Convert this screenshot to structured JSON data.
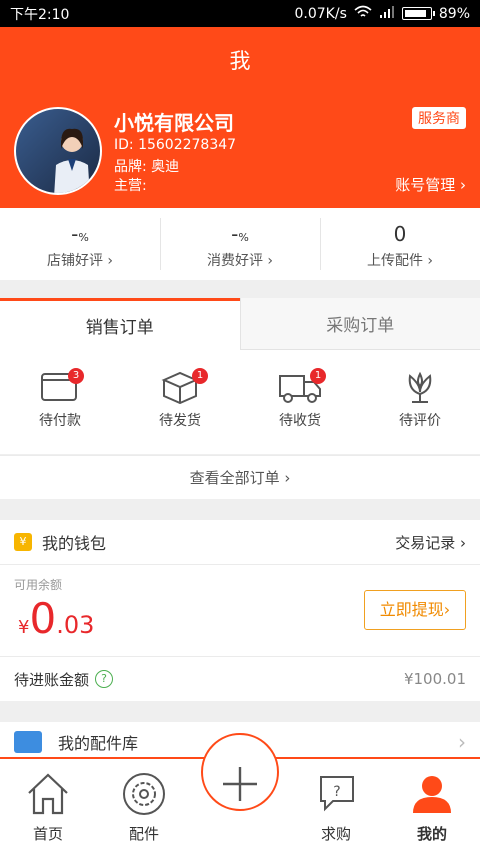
{
  "status_bar": {
    "time": "下午2:10",
    "speed": "0.07K/s",
    "battery": "89%",
    "battery_level": 0.89
  },
  "header": {
    "title": "我",
    "company": "小悦有限公司",
    "id_line": "ID: 15602278347",
    "brand_line": "品牌: 奥迪",
    "main_line": "主营:",
    "service_badge": "服务商",
    "account_mgmt": "账号管理 ›"
  },
  "stats": [
    {
      "value": "-",
      "unit": "%",
      "label": "店铺好评 ›"
    },
    {
      "value": "-",
      "unit": "%",
      "label": "消费好评 ›"
    },
    {
      "value": "0",
      "unit": "",
      "label": "上传配件 ›"
    }
  ],
  "order_tabs": {
    "sales": "销售订单",
    "purchase": "采购订单"
  },
  "order_status": [
    {
      "label": "待付款",
      "icon": "wallet-icon",
      "badge": "3"
    },
    {
      "label": "待发货",
      "icon": "box-icon",
      "badge": "1"
    },
    {
      "label": "待收货",
      "icon": "truck-icon",
      "badge": "1"
    },
    {
      "label": "待评价",
      "icon": "flower-icon",
      "badge": ""
    }
  ],
  "view_all": "查看全部订单 ›",
  "wallet": {
    "title": "我的钱包",
    "icon_glyph": "¥",
    "records": "交易记录 ›",
    "available_label": "可用余额",
    "currency": "¥",
    "amount_int": "0",
    "amount_dec": ".03",
    "withdraw": "立即提现›",
    "pending_label": "待进账金额",
    "help_glyph": "?",
    "pending_amount": "¥100.01"
  },
  "parts": {
    "title": "我的配件库",
    "arrow": "›"
  },
  "tabbar": [
    {
      "label": "首页",
      "icon": "home-icon"
    },
    {
      "label": "配件",
      "icon": "gear-icon"
    },
    {
      "label": "",
      "icon": "plus-icon"
    },
    {
      "label": "求购",
      "icon": "question-chat-icon"
    },
    {
      "label": "我的",
      "icon": "person-icon"
    }
  ],
  "colors": {
    "accent": "#ff4a18",
    "badge": "#e8282b",
    "money": "#e8282b",
    "withdraw": "#f08a00"
  }
}
